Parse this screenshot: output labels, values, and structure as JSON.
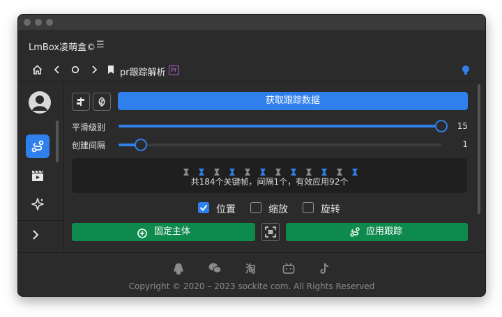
{
  "app": {
    "title": "LmBox凌萌盒©"
  },
  "navbar": {
    "breadcrumb": "pr跟踪解析",
    "badge": "Pr"
  },
  "main": {
    "fetch_button": "获取跟踪数据",
    "sliders": [
      {
        "label": "平滑级别",
        "value": "15",
        "fraction": 1.0
      },
      {
        "label": "创建间隔",
        "value": "1",
        "fraction": 0.07
      }
    ],
    "keyframe_summary": "共184个关键帧，间隔1个，有效应用92个",
    "options": [
      {
        "label": "位置",
        "checked": true
      },
      {
        "label": "缩放",
        "checked": false
      },
      {
        "label": "旋转",
        "checked": false
      }
    ],
    "fix_subject_button": "固定主体",
    "apply_tracking_button": "应用跟踪"
  },
  "footer": {
    "copyright": "Copyright © 2020 – 2023 sockite com. All Rights Reserved",
    "social_icons": [
      "qq-icon",
      "wechat-icon",
      "taobao-icon",
      "bilibili-icon",
      "tiktok-icon"
    ]
  },
  "colors": {
    "accent": "#2f80ed",
    "green": "#0f8a4e",
    "background": "#2b2b2b"
  }
}
